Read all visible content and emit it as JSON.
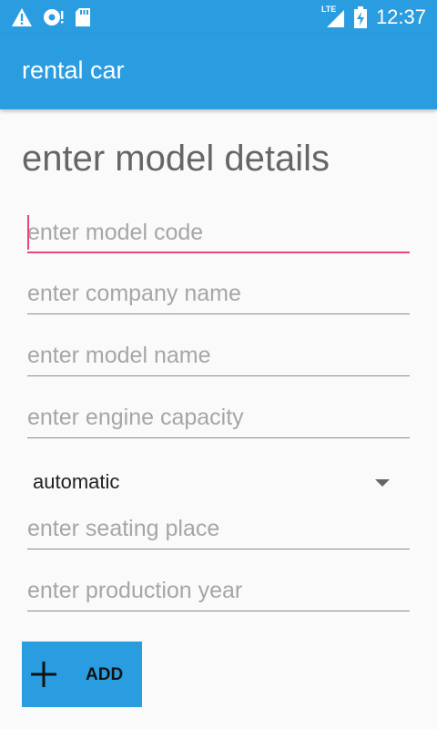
{
  "status_bar": {
    "time": "12:37",
    "network_label": "LTE",
    "left_icons": [
      "warning-icon",
      "sync-icon",
      "sd-card-icon"
    ],
    "right_icons": [
      "lte-signal-icon",
      "battery-icon"
    ]
  },
  "app_bar": {
    "title": "rental car"
  },
  "form": {
    "heading": "enter model details",
    "model_code_placeholder": "enter model code",
    "company_name_placeholder": "enter company name",
    "model_name_placeholder": "enter model name",
    "engine_capacity_placeholder": "enter engine capacity",
    "transmission_value": "automatic",
    "seating_place_placeholder": "enter seating place",
    "production_year_placeholder": "enter production year",
    "add_label": "ADD"
  },
  "colors": {
    "primary": "#2a9de0",
    "accent": "#e8467c",
    "background": "#fafafa"
  }
}
